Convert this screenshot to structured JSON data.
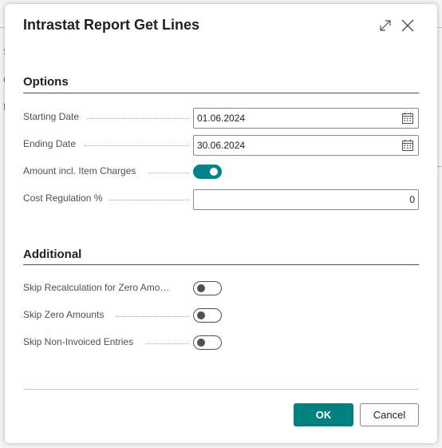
{
  "dialog": {
    "title": "Intrastat Report Get Lines",
    "expand_icon": "expand-icon",
    "close_icon": "close-icon"
  },
  "background_fragments": [
    "S",
    "C",
    "F"
  ],
  "options": {
    "section_title": "Options",
    "starting_date_label": "Starting Date",
    "starting_date_value": "01.06.2024",
    "ending_date_label": "Ending Date",
    "ending_date_value": "30.06.2024",
    "amount_incl_item_charges_label": "Amount incl. Item Charges",
    "amount_incl_item_charges_on": true,
    "cost_regulation_label": "Cost Regulation %",
    "cost_regulation_value": "0"
  },
  "additional": {
    "section_title": "Additional",
    "skip_recalc_label": "Skip Recalculation for Zero Amo…",
    "skip_recalc_on": false,
    "skip_zero_amounts_label": "Skip Zero Amounts",
    "skip_zero_amounts_on": false,
    "skip_non_invoiced_label": "Skip Non-Invoiced Entries",
    "skip_non_invoiced_on": false
  },
  "footer": {
    "ok_label": "OK",
    "cancel_label": "Cancel"
  },
  "colors": {
    "accent": "#008489",
    "ok_button": "#00807f",
    "text": "#212121",
    "label_text": "#505050"
  }
}
